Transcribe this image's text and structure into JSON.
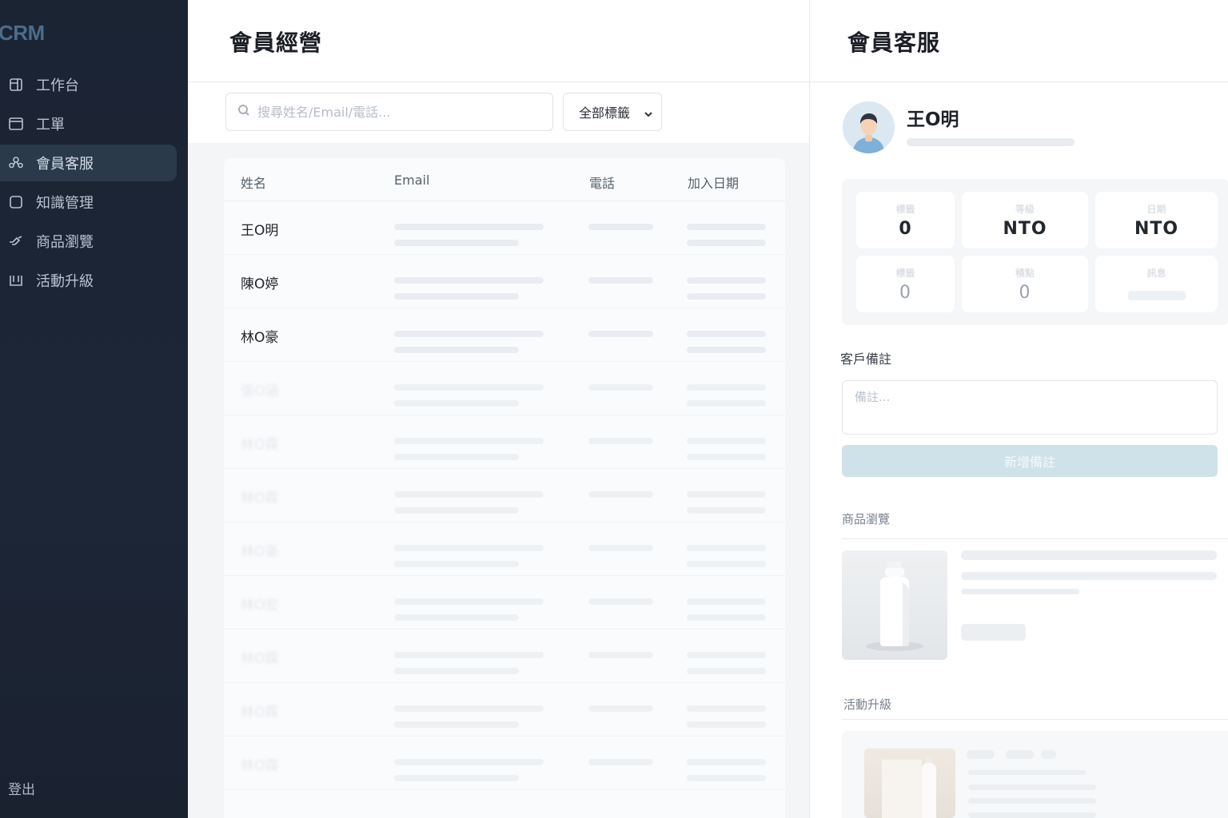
{
  "sidebar": {
    "brand": "CRM",
    "items": [
      {
        "label": "工作台",
        "icon": "dashboard-icon",
        "active": false
      },
      {
        "label": "工單",
        "icon": "ticket-icon",
        "active": false
      },
      {
        "label": "會員客服",
        "icon": "members-icon",
        "active": true
      },
      {
        "label": "知識管理",
        "icon": "knowledge-icon",
        "active": false
      },
      {
        "label": "商品瀏覽",
        "icon": "product-icon",
        "active": false
      },
      {
        "label": "活動升級",
        "icon": "event-icon",
        "active": false
      }
    ],
    "logout": "登出"
  },
  "middle": {
    "title": "會員經營",
    "search_placeholder": "搜尋姓名/Email/電話...",
    "filter_value": "全部標籤",
    "columns": [
      "姓名",
      "Email",
      "電話",
      "加入日期"
    ],
    "rows": [
      {
        "name": "王O明"
      },
      {
        "name": "陳O婷"
      },
      {
        "name": "林O豪"
      },
      {
        "name": "張O涵"
      },
      {
        "name": "林O霖"
      },
      {
        "name": "林O霖"
      },
      {
        "name": "林O豪"
      },
      {
        "name": "林O宏"
      },
      {
        "name": "林O霖"
      },
      {
        "name": "林O霖"
      },
      {
        "name": "林O霖"
      }
    ]
  },
  "right": {
    "title": "會員客服",
    "member_name": "王O明",
    "stats": [
      {
        "label": "標籤",
        "value": "0"
      },
      {
        "label": "等級",
        "value": "NTO"
      },
      {
        "label": "日期",
        "value": "NTO"
      },
      {
        "label": "標籤",
        "value": "0"
      },
      {
        "label": "積點",
        "value": "0"
      },
      {
        "label": "訊息",
        "value": ""
      }
    ],
    "notes_label": "客戶備註",
    "notes_placeholder": "備註...",
    "add_note_button": "新增備註",
    "product_section": "商品瀏覽",
    "progress_section": "活動升級"
  }
}
